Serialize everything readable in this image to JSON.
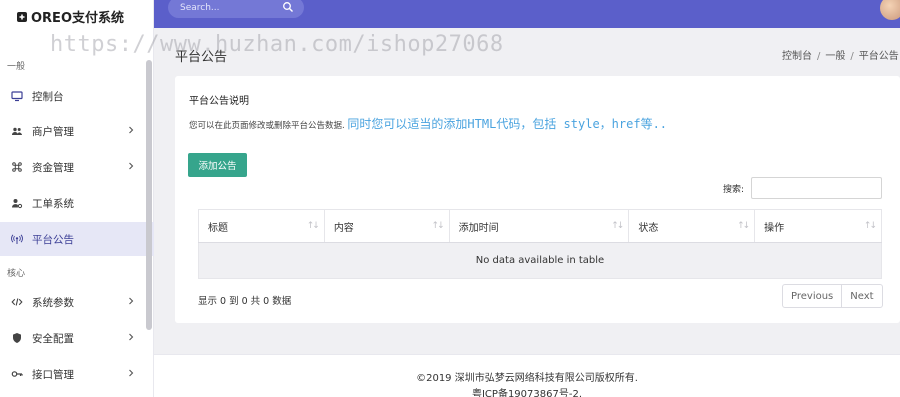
{
  "brand": {
    "title": "OREO支付系统"
  },
  "topbar": {
    "search_placeholder": "Search..."
  },
  "sidebar": {
    "sections": [
      {
        "label": "一般"
      },
      {
        "label": "核心"
      }
    ],
    "items": [
      {
        "label": "控制台",
        "icon": "monitor-icon",
        "has_children": false
      },
      {
        "label": "商户管理",
        "icon": "users-icon",
        "has_children": true
      },
      {
        "label": "资金管理",
        "icon": "command-icon",
        "has_children": true
      },
      {
        "label": "工单系统",
        "icon": "user-gear-icon",
        "has_children": false
      },
      {
        "label": "平台公告",
        "icon": "broadcast-icon",
        "has_children": false,
        "active": true
      },
      {
        "label": "系统参数",
        "icon": "code-icon",
        "has_children": true
      },
      {
        "label": "安全配置",
        "icon": "shield-icon",
        "has_children": true
      },
      {
        "label": "接口管理",
        "icon": "key-icon",
        "has_children": true
      }
    ]
  },
  "page": {
    "title": "平台公告",
    "breadcrumb": [
      "控制台",
      "一般",
      "平台公告"
    ]
  },
  "card": {
    "title": "平台公告说明",
    "desc": "您可以在此页面修改或删除平台公告数据.",
    "hint": "同时您可以适当的添加HTML代码，包括 style，href等..",
    "add_button": "添加公告",
    "search_label": "搜索:",
    "table": {
      "columns": [
        "标题",
        "内容",
        "添加时间",
        "状态",
        "操作"
      ],
      "empty_text": "No data available in table"
    },
    "info": "显示 0 到 0 共 0 数据",
    "pagination": {
      "previous": "Previous",
      "next": "Next"
    }
  },
  "footer": {
    "copyright": "©2019 深圳市弘梦云网络科技有限公司版权所有.",
    "icp": "粤ICP备19073867号-2."
  },
  "watermark": "https://www.huzhan.com/ishop27068",
  "colors": {
    "topbar": "#5b5fca",
    "active_bg": "#e6e7f6",
    "accent_button": "#36a58c"
  }
}
